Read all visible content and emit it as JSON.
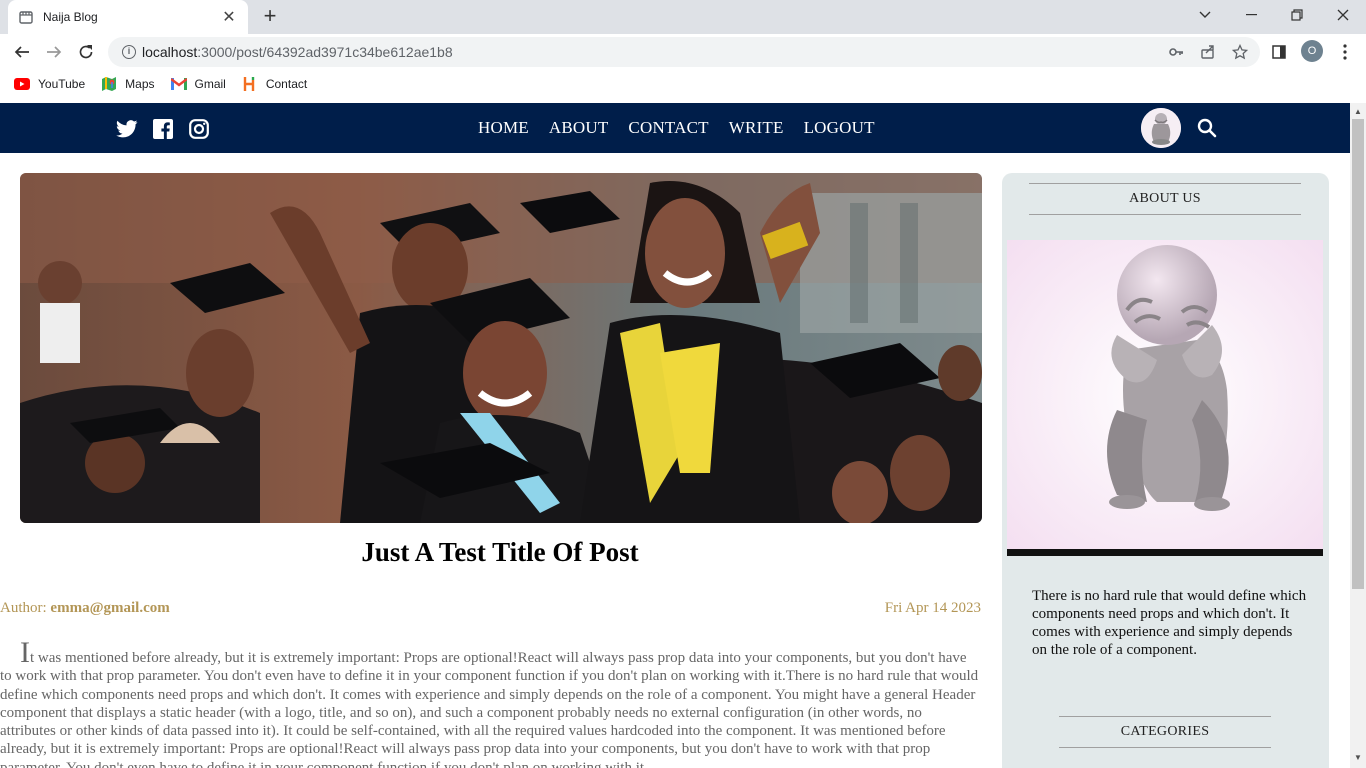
{
  "browser": {
    "tab_title": "Naija Blog",
    "url_host": "localhost",
    "url_rest": ":3000/post/64392ad3971c34be612ae1b8",
    "profile_initial": "O",
    "bookmarks": [
      {
        "label": "YouTube",
        "icon": "youtube-icon"
      },
      {
        "label": "Maps",
        "icon": "maps-icon"
      },
      {
        "label": "Gmail",
        "icon": "gmail-icon"
      },
      {
        "label": "Contact",
        "icon": "contact-icon"
      }
    ]
  },
  "site": {
    "nav": {
      "home": "HOME",
      "about": "ABOUT",
      "contact": "CONTACT",
      "write": "WRITE",
      "logout": "LOGOUT"
    },
    "colors": {
      "navbar": "#001e4a",
      "meta": "#b39656",
      "sidebar": "#e2e9ea"
    }
  },
  "post": {
    "title": "Just A Test Title Of Post",
    "author_label": "Author: ",
    "author": "emma@gmail.com",
    "date": "Fri Apr 14 2023",
    "body_first_letter": "I",
    "body_rest": "t was mentioned before already, but it is extremely important: Props are optional!React will always pass prop data into your components, but you don't have to work with that prop parameter. You don't even have to define it in your component function if you don't plan on working with it.There is no hard rule that would define which components need props and which don't. It comes with experience and simply depends on the role of a component. You might have a general Header component that displays a static header (with a logo, title, and so on), and such a component probably needs no external configuration (in other words, no attributes or other kinds of data passed into it). It could be self-contained, with all the required values hardcoded into the component. It was mentioned before already, but it is extremely important: Props are optional!React will always pass prop data into your components, but you don't have to work with that prop parameter. You don't even have to define it in your component function if you don't plan on working with it."
  },
  "sidebar": {
    "about_title": "ABOUT US",
    "about_text": "There is no hard rule that would define which components need props and which don't. It comes with experience and simply depends on the role of a component.",
    "categories_title": "CATEGORIES"
  }
}
